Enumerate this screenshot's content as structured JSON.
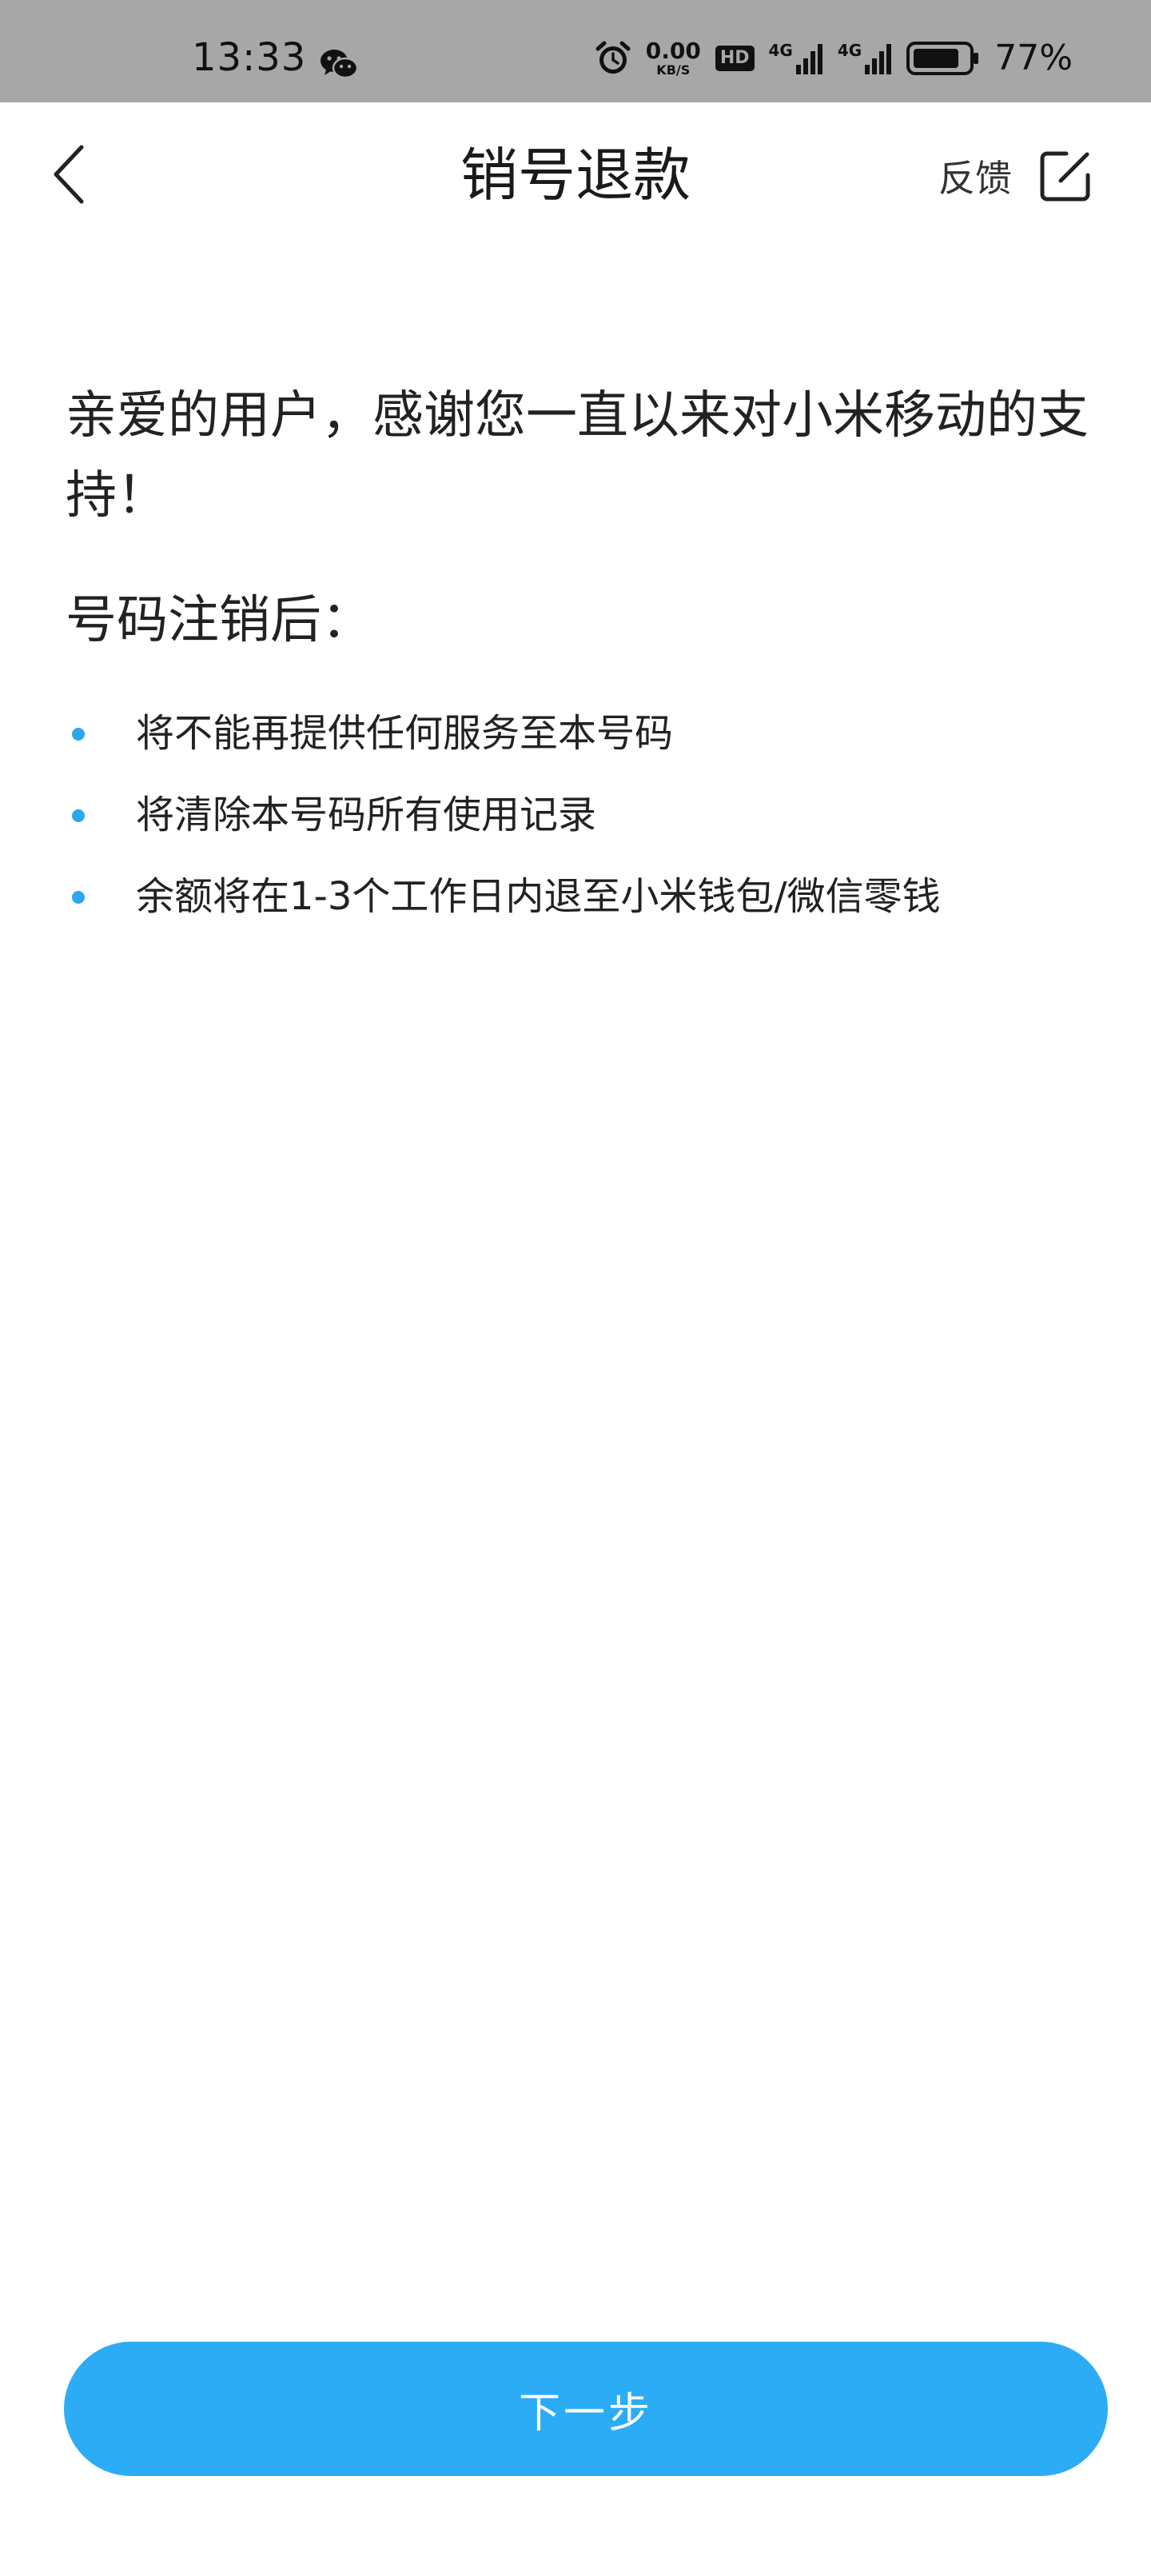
{
  "status_bar": {
    "time": "13:33",
    "net_speed_value": "0.00",
    "net_speed_unit": "KB/S",
    "hd_badge": "HD",
    "network_1": "4G",
    "network_2": "4G",
    "battery_percent": "77%"
  },
  "header": {
    "title": "销号退款",
    "feedback_label": "反馈"
  },
  "content": {
    "intro": "亲爱的用户，感谢您一直以来对小米移动的支持！",
    "section_title": "号码注销后：",
    "bullets": [
      "将不能再提供任何服务至本号码",
      "将清除本号码所有使用记录",
      "余额将在1-3个工作日内退至小米钱包/微信零钱"
    ]
  },
  "footer": {
    "next_label": "下一步"
  },
  "colors": {
    "accent": "#2bacf5",
    "status_bar_bg": "#a7a7a7",
    "bullet": "#2aa7ef"
  },
  "icons": {
    "back": "chevron-left-icon",
    "feedback": "edit-icon",
    "status_wechat": "wechat-icon",
    "status_alarm": "alarm-icon",
    "status_signal": "signal-icon",
    "status_battery": "battery-icon"
  }
}
